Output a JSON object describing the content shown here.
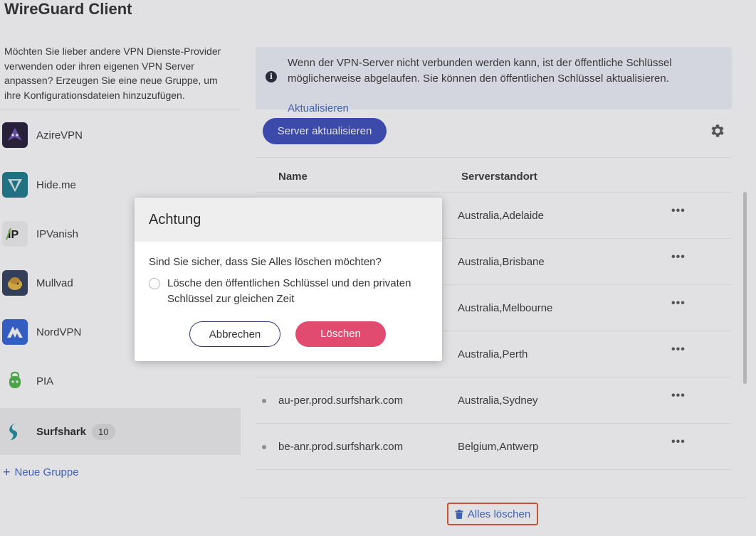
{
  "app": {
    "title": "WireGuard Client"
  },
  "sidebar": {
    "description": "Möchten Sie lieber andere VPN Dienste-Provider verwenden oder ihren eigenen VPN Server anpassen? Erzeugen Sie eine neue Gruppe, um ihre Konfigurationsdateien hinzuzufügen.",
    "providers": [
      {
        "name": "AzireVPN",
        "icon": "azirevpn-logo",
        "color": "#1e1430"
      },
      {
        "name": "Hide.me",
        "icon": "hideme-logo",
        "color": "#14788a"
      },
      {
        "name": "IPVanish",
        "icon": "ipvanish-logo",
        "color": "#f2f2f2"
      },
      {
        "name": "Mullvad",
        "icon": "mullvad-logo",
        "color": "#2b3a56"
      },
      {
        "name": "NordVPN",
        "icon": "nordvpn-logo",
        "color": "#2d5fd6"
      },
      {
        "name": "PIA",
        "icon": "pia-logo",
        "color": "#4bb543"
      },
      {
        "name": "Surfshark",
        "icon": "surfshark-logo",
        "color": "#178a9a",
        "badge": "10",
        "active": true
      }
    ],
    "add_group": "Neue Gruppe"
  },
  "main": {
    "info": {
      "text": "Wenn der VPN-Server nicht verbunden werden kann, ist der öffentliche Schlüssel möglicherweise abgelaufen. Sie können den öffentlichen Schlüssel aktualisieren.",
      "link": "Aktualisieren"
    },
    "refresh_button": "Server aktualisieren",
    "table": {
      "headers": {
        "name": "Name",
        "location": "Serverstandort"
      },
      "rows": [
        {
          "name": "",
          "location": "Australia,Adelaide"
        },
        {
          "name": "",
          "location": "Australia,Brisbane"
        },
        {
          "name": "",
          "location": "Australia,Melbourne"
        },
        {
          "name": "",
          "location": "Australia,Perth"
        },
        {
          "name": "au-per.prod.surfshark.com",
          "location": "Australia,Sydney"
        },
        {
          "name": "be-anr.prod.surfshark.com",
          "location": "Belgium,Antwerp"
        }
      ],
      "more_label": "•••"
    },
    "delete_all": "Alles löschen"
  },
  "dialog": {
    "title": "Achtung",
    "question": "Sind Sie sicher, dass Sie Alles löschen möchten?",
    "option": "Lösche den öffentlichen Schlüssel und den privaten Schlüssel zur gleichen Zeit",
    "cancel": "Abbrechen",
    "confirm": "Löschen"
  },
  "colors": {
    "primary": "#3649b9",
    "danger": "#e04b6f",
    "link": "#3b63c4",
    "highlight": "#e2502b"
  }
}
